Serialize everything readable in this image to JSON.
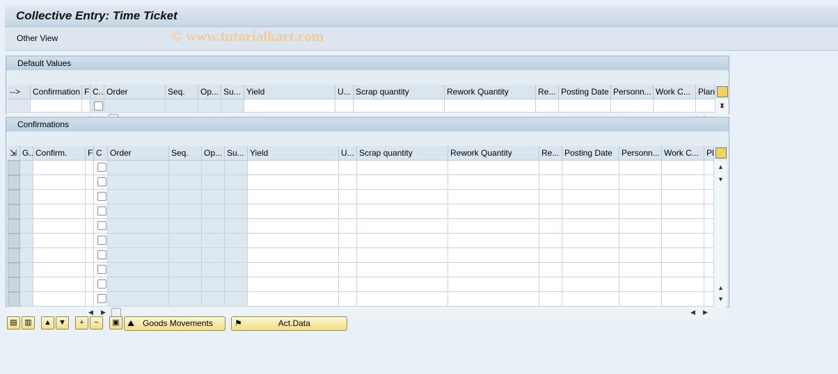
{
  "title": "Collective Entry: Time Ticket",
  "toolbar": {
    "other_view": "Other View"
  },
  "watermark": "© www.tutorialkart.com",
  "default_values": {
    "header": "Default Values",
    "columns": [
      "-->",
      "Confirmation",
      "F",
      "C..",
      "Order",
      "Seq.",
      "Op...",
      "Su...",
      "Yield",
      "U...",
      "Scrap quantity",
      "Rework Quantity",
      "Re...",
      "Posting Date",
      "Personn...",
      "Work C...",
      "Plant"
    ],
    "rows": 1
  },
  "confirmations": {
    "header": "Confirmations",
    "columns": [
      "",
      "G..",
      "Confirm.",
      "F",
      "C",
      "Order",
      "Seq.",
      "Op...",
      "Su...",
      "Yield",
      "U...",
      "Scrap quantity",
      "Rework Quantity",
      "Re...",
      "Posting Date",
      "Personn...",
      "Work C...",
      "Plant"
    ],
    "rows": 10
  },
  "buttons": {
    "goods_movements": "Goods Movements",
    "act_data": "Act.Data"
  },
  "icons": [
    "select-all-icon",
    "deselect-all-icon",
    "sort-ascending-icon",
    "filter-icon",
    "insert-row-icon",
    "delete-row-icon",
    "details-icon"
  ]
}
